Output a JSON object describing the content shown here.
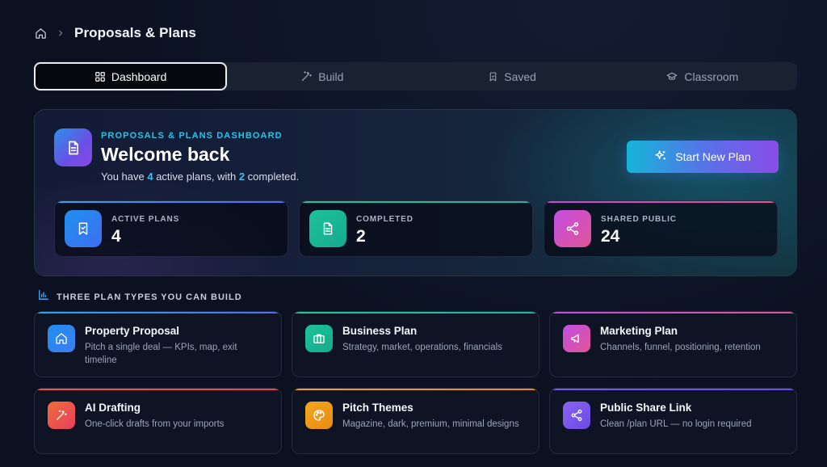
{
  "breadcrumb": {
    "home_icon": "home-icon",
    "separator_icon": "chevron-right-icon",
    "title": "Proposals & Plans"
  },
  "tabs": [
    {
      "label": "Dashboard",
      "icon": "grid-icon",
      "active": true
    },
    {
      "label": "Build",
      "icon": "magic-wand-icon",
      "active": false
    },
    {
      "label": "Saved",
      "icon": "bookmark-icon",
      "active": false
    },
    {
      "label": "Classroom",
      "icon": "graduation-cap-icon",
      "active": false
    }
  ],
  "hero": {
    "icon": "document-icon",
    "kicker": "PROPOSALS & PLANS DASHBOARD",
    "title": "Welcome back",
    "subtitle": {
      "prefix": "You have ",
      "active_count": "4",
      "middle": " active plans, with ",
      "completed_count": "2",
      "suffix": " completed."
    },
    "cta": {
      "label": "Start New Plan",
      "icon": "sparkle-icon"
    }
  },
  "stats": [
    {
      "label": "ACTIVE PLANS",
      "value": "4",
      "icon": "bookmark-check-icon"
    },
    {
      "label": "COMPLETED",
      "value": "2",
      "icon": "document-icon"
    },
    {
      "label": "SHARED PUBLIC",
      "value": "24",
      "icon": "share-icon"
    }
  ],
  "section": {
    "icon": "bar-chart-icon",
    "title": "THREE PLAN TYPES YOU CAN BUILD"
  },
  "cards": [
    {
      "title": "Property Proposal",
      "desc": "Pitch a single deal — KPIs, map, exit timeline",
      "icon": "home-icon"
    },
    {
      "title": "Business Plan",
      "desc": "Strategy, market, operations, financials",
      "icon": "briefcase-icon"
    },
    {
      "title": "Marketing Plan",
      "desc": "Channels, funnel, positioning, retention",
      "icon": "megaphone-icon"
    },
    {
      "title": "AI Drafting",
      "desc": "One-click drafts from your imports",
      "icon": "magic-wand-icon"
    },
    {
      "title": "Pitch Themes",
      "desc": "Magazine, dark, premium, minimal designs",
      "icon": "palette-icon"
    },
    {
      "title": "Public Share Link",
      "desc": "Clean /plan URL — no login required",
      "icon": "share-icon"
    }
  ],
  "colors": {
    "background": "#0b1120",
    "accent_cyan": "#22c4e8",
    "accent_purple": "#8a4ce8",
    "blue": "#2aa6ee",
    "green": "#1fc898",
    "magenta": "#c44ee2",
    "orange_red": "#f0563e",
    "amber": "#f0a21a",
    "violet": "#7a58ec"
  }
}
